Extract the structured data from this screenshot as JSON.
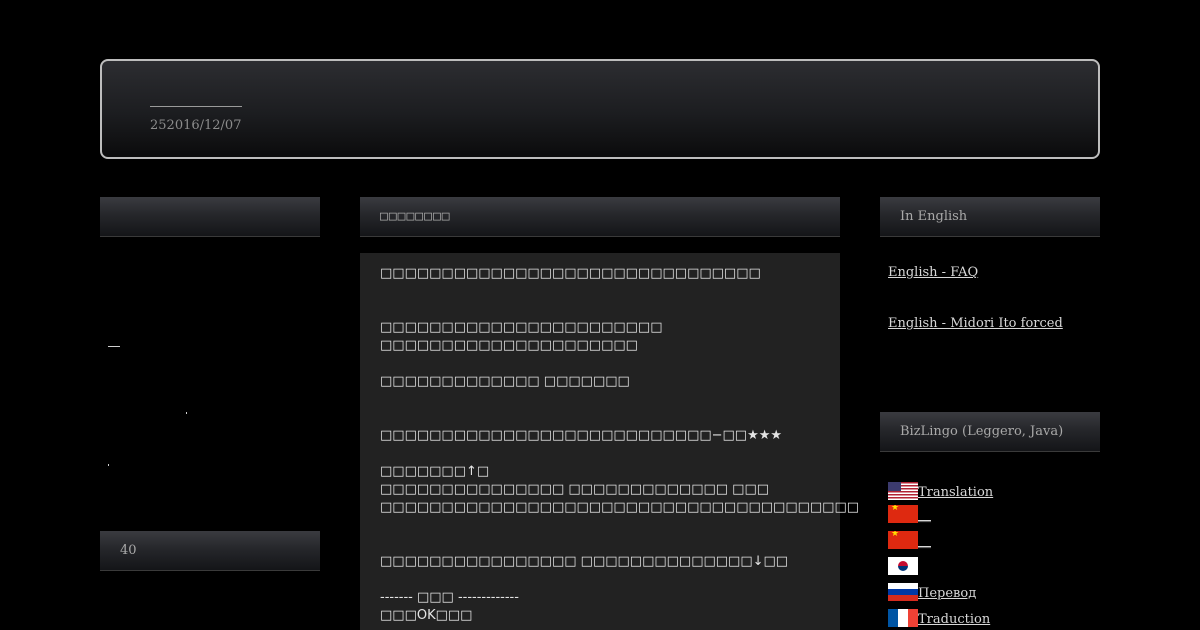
{
  "header": {
    "date": "252016/12/07"
  },
  "left_sidebar": {
    "bar1_title": "",
    "bar2_title": "40"
  },
  "main": {
    "title": "□□□□□□□□",
    "lines": [
      "□□□□□□□□□□□□□□□□□□□□□□□□□□□□□□□",
      "",
      "",
      "□□□□□□□□□□□□□□□□□□□□□□□",
      "□□□□□□□□□□□□□□□□□□□□□",
      "",
      "□□□□□□□□□□□□□ □□□□□□□",
      "",
      "",
      "□□□□□□□□□□□□□□□□□□□□□□□□□□□−□□★★★",
      "",
      "□□□□□□□↑□",
      "□□□□□□□□□□□□□□□ □□□□□□□□□□□□□ □□□",
      "□□□□□□□□□□□□□□□□□□□□□□□□□□□□□□□□□□□□□□□",
      "",
      "",
      "□□□□□□□□□□□□□□□□ □□□□□□□□□□□□□□↓□□",
      "",
      "------- □□□ -------------",
      "□□□OK□□□"
    ]
  },
  "right_sidebar": {
    "bar1_title": "In English",
    "links": [
      "English - FAQ",
      "English - Midori Ito forced"
    ],
    "bar2_title": "BizLingo (Leggero, Java)",
    "languages": [
      {
        "flag": "us-flag-icon",
        "label": "Translation"
      },
      {
        "flag": "cn-flag-icon",
        "label": "__"
      },
      {
        "flag": "cn-flag-icon",
        "label": "__"
      },
      {
        "flag": "kr-flag-icon",
        "label": ""
      },
      {
        "flag": "ru-flag-icon",
        "label": "Перевод"
      },
      {
        "flag": "fr-flag-icon",
        "label": "Traduction"
      }
    ]
  }
}
